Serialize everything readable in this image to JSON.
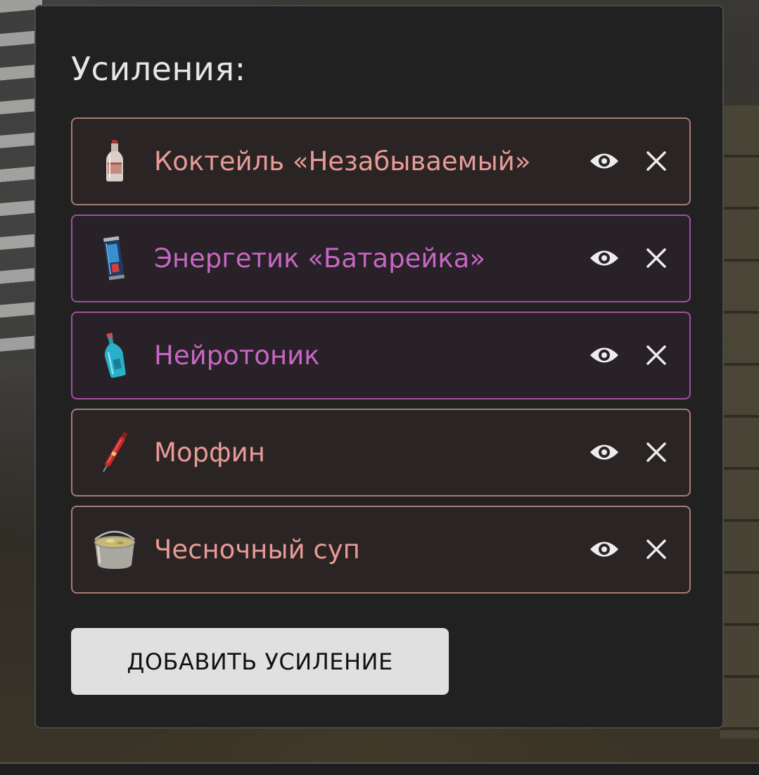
{
  "panel": {
    "title": "Усиления:"
  },
  "boosts": [
    {
      "name": "Коктейль «Незабываемый»",
      "icon": "bottle-icon",
      "color": "#e89a96"
    },
    {
      "name": "Энергетик «Батарейка»",
      "icon": "energy-can-icon",
      "color": "#c866c4"
    },
    {
      "name": "Нейротоник",
      "icon": "blue-bottle-icon",
      "color": "#c866c4"
    },
    {
      "name": "Морфин",
      "icon": "syringe-icon",
      "color": "#e89a96"
    },
    {
      "name": "Чесночный суп",
      "icon": "soup-pot-icon",
      "color": "#e89a96"
    }
  ],
  "actions": {
    "view_icon": "eye-icon",
    "remove_icon": "close-icon"
  },
  "add_button": {
    "label": "ДОБАВИТЬ УСИЛЕНИЕ"
  }
}
